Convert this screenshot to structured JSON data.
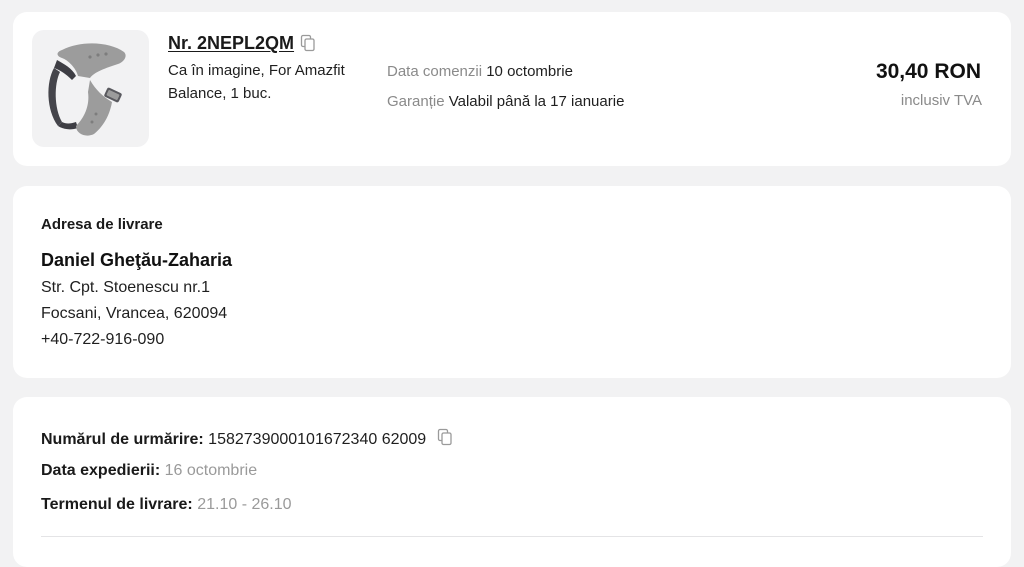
{
  "order": {
    "number": "Nr. 2NEPL2QM",
    "description_lines": [
      "Ca în imagine, For Amazfit",
      "Balance, 1 buc."
    ],
    "order_date_label": "Data comenzii",
    "order_date_value": "10 octombrie",
    "warranty_label": "Garanție",
    "warranty_value": "Valabil până la 17 ianuarie",
    "price": "30,40 RON",
    "vat_note": "inclusiv TVA",
    "product_image_icon": "watch-strap-image"
  },
  "address": {
    "title": "Adresa de livrare",
    "recipient": "Daniel Gheţău-Zaharia",
    "street": "Str. Cpt. Stoenescu nr.1",
    "city": "Focsani, Vrancea, 620094",
    "phone": "+40-722-916-090"
  },
  "shipment": {
    "tracking_label": "Numărul de urmărire:",
    "tracking_value": "1582739000101672340 62009",
    "ship_date_label": "Data expedierii:",
    "ship_date_value": "16 octombrie",
    "delivery_term_label": "Termenul de livrare:",
    "delivery_term_value": "21.10 - 26.10"
  },
  "colors": {
    "page_background": "#f2f2f3",
    "card_background": "#ffffff",
    "muted_text": "#8a8a8a",
    "strap_gray": "#9c9c9c"
  }
}
